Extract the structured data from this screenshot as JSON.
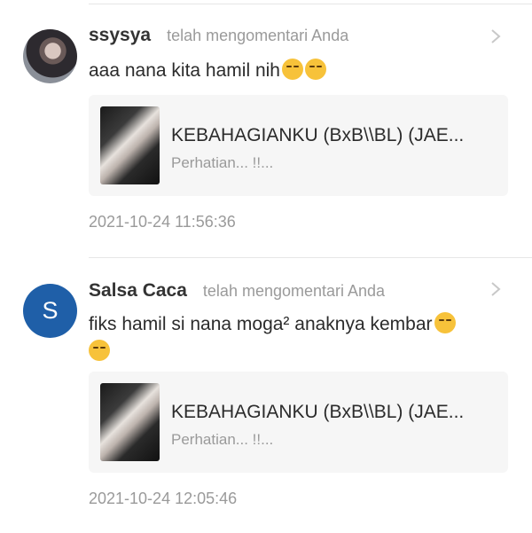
{
  "notifications": [
    {
      "user": "ssysya",
      "action": "telah mengomentari Anda",
      "avatar": "photo-avatar",
      "comment": "aaa nana kita hamil nih",
      "emojis": [
        "relieved-face",
        "yum-face"
      ],
      "story_title": "KEBAHAGIANKU (BxB\\\\BL) (JAE...",
      "story_excerpt": "Perhatian... !!...",
      "timestamp": "2021-10-24 11:56:36"
    },
    {
      "user": "Salsa Caca",
      "action": "telah mengomentari Anda",
      "avatar_letter": "S",
      "avatar_color": "#1f5fa8",
      "comment": "fiks hamil si nana moga² anaknya kembar",
      "emojis": [
        "hand-over-mouth-face",
        "hand-over-mouth-face"
      ],
      "story_title": "KEBAHAGIANKU (BxB\\\\BL) (JAE...",
      "story_excerpt": "Perhatian... !!...",
      "timestamp": "2021-10-24 12:05:46"
    }
  ]
}
